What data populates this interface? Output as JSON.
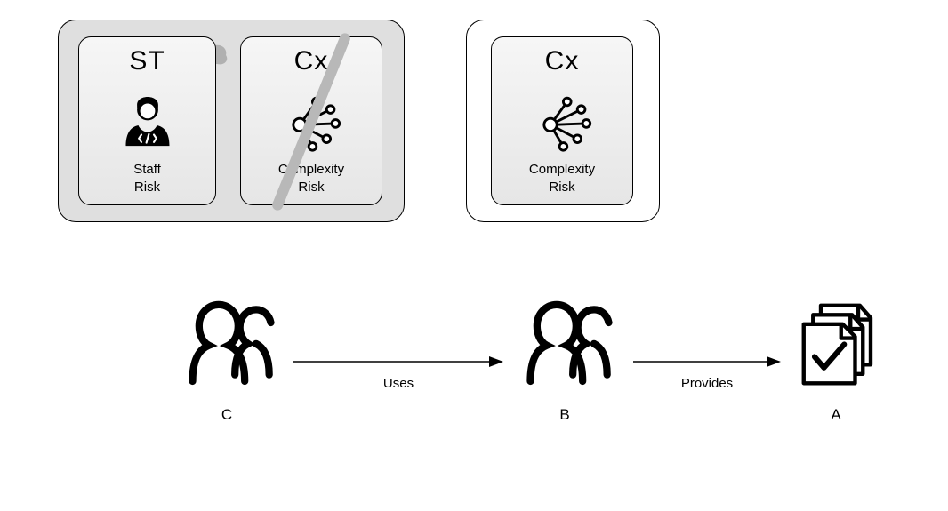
{
  "cards": {
    "st": {
      "code": "ST",
      "label_l1": "Staff",
      "label_l2": "Risk"
    },
    "cx1": {
      "code": "Cx",
      "label_l1": "Complexity",
      "label_l2": "Risk"
    },
    "cx2": {
      "code": "Cx",
      "label_l1": "Complexity",
      "label_l2": "Risk"
    }
  },
  "actors": {
    "c": {
      "label": "C"
    },
    "b": {
      "label": "B"
    },
    "a": {
      "label": "A"
    }
  },
  "arrows": {
    "uses": {
      "label": "Uses"
    },
    "provides": {
      "label": "Provides"
    }
  }
}
